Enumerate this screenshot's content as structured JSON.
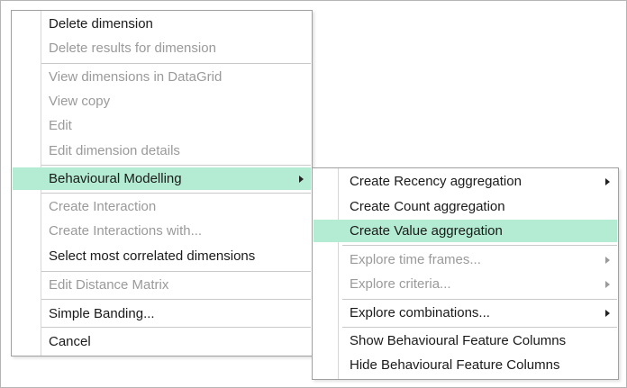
{
  "main_menu": {
    "items": [
      {
        "label": "Delete dimension",
        "enabled": true
      },
      {
        "label": "Delete results for dimension",
        "enabled": false
      },
      {
        "label": "View dimensions in DataGrid",
        "enabled": false
      },
      {
        "label": "View copy",
        "enabled": false
      },
      {
        "label": "Edit",
        "enabled": false
      },
      {
        "label": "Edit dimension details",
        "enabled": false
      },
      {
        "label": "Behavioural Modelling",
        "enabled": true,
        "highlighted": true,
        "submenu_icon": "chevron-right-icon"
      },
      {
        "label": "Create Interaction",
        "enabled": false
      },
      {
        "label": "Create Interactions with...",
        "enabled": false
      },
      {
        "label": "Select most correlated dimensions",
        "enabled": true
      },
      {
        "label": "Edit Distance Matrix",
        "enabled": false
      },
      {
        "label": "Simple Banding...",
        "enabled": true
      },
      {
        "label": "Cancel",
        "enabled": true
      }
    ]
  },
  "sub_menu": {
    "items": [
      {
        "label": "Create Recency aggregation",
        "enabled": true,
        "submenu_icon": "chevron-right-icon"
      },
      {
        "label": "Create Count aggregation",
        "enabled": true
      },
      {
        "label": "Create Value aggregation",
        "enabled": true,
        "highlighted": true
      },
      {
        "label": "Explore time frames...",
        "enabled": false,
        "submenu_icon": "chevron-right-icon"
      },
      {
        "label": "Explore criteria...",
        "enabled": false,
        "submenu_icon": "chevron-right-icon"
      },
      {
        "label": "Explore combinations...",
        "enabled": true,
        "submenu_icon": "chevron-right-icon"
      },
      {
        "label": "Show Behavioural Feature Columns",
        "enabled": true
      },
      {
        "label": "Hide Behavioural Feature Columns",
        "enabled": true
      }
    ]
  },
  "colors": {
    "highlight": "#b3ecd2",
    "text": "#1a1a1a",
    "disabled_text": "#9a9a9a",
    "border": "#a0a0a0"
  }
}
